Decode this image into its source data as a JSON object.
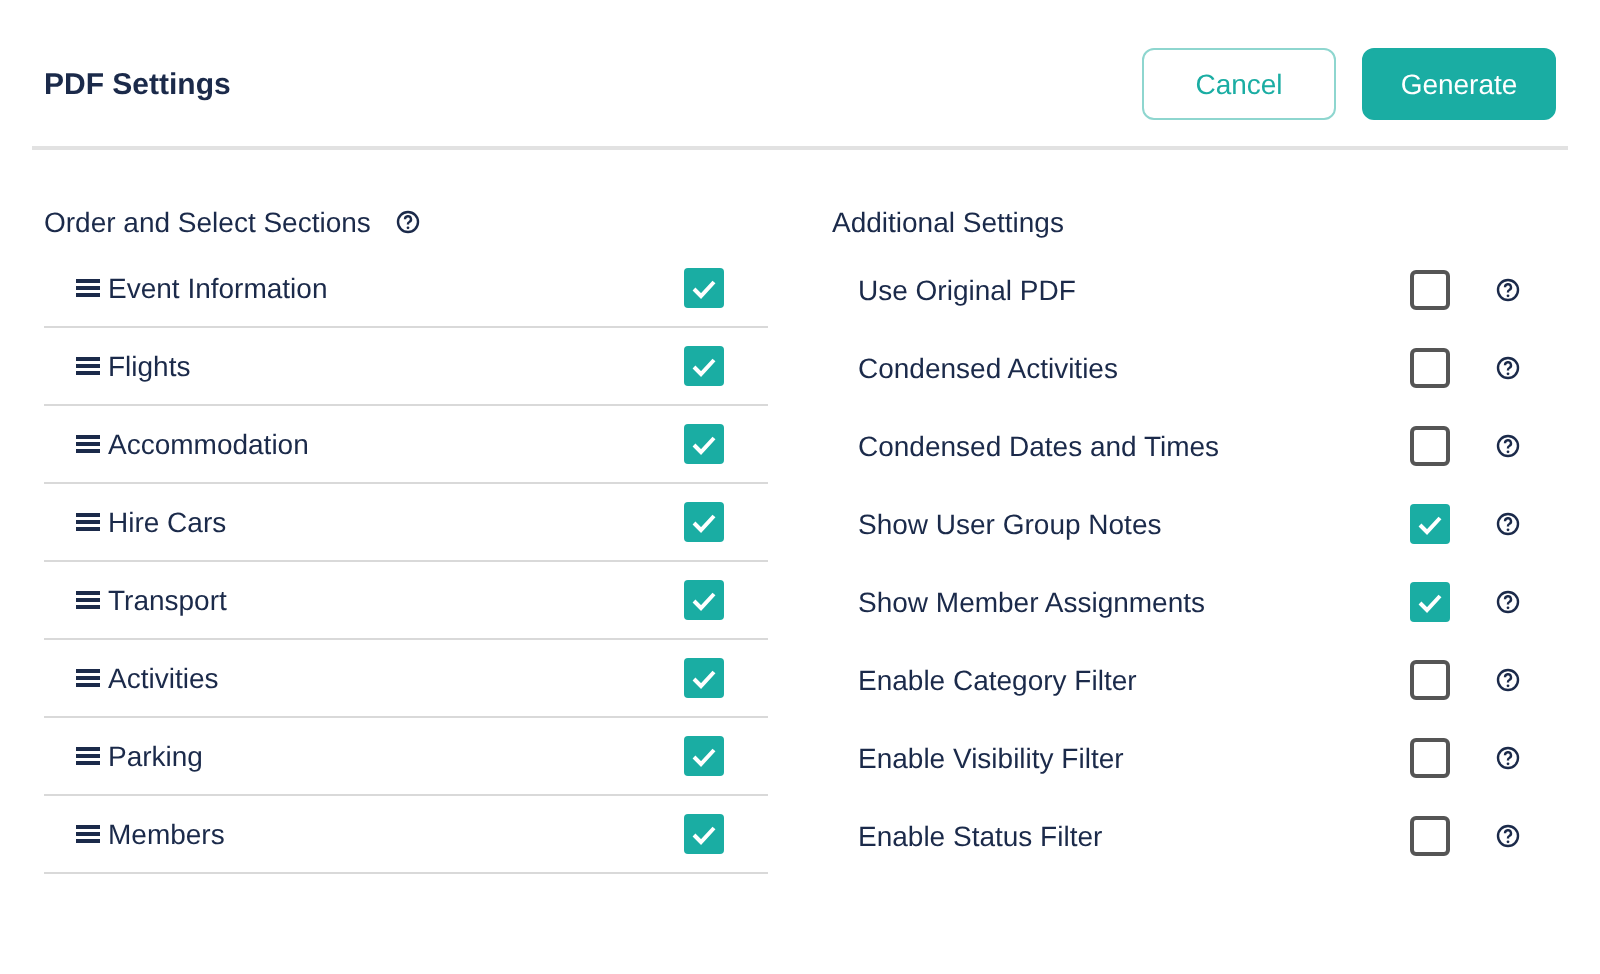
{
  "header": {
    "title": "PDF Settings",
    "buttons": [
      {
        "label": "Cancel",
        "kind": "secondary"
      },
      {
        "label": "Generate",
        "kind": "primary"
      }
    ]
  },
  "sections": {
    "title": "Order and Select Sections",
    "items": [
      {
        "label": "Event Information",
        "checked": true
      },
      {
        "label": "Flights",
        "checked": true
      },
      {
        "label": "Accommodation",
        "checked": true
      },
      {
        "label": "Hire Cars",
        "checked": true
      },
      {
        "label": "Transport",
        "checked": true
      },
      {
        "label": "Activities",
        "checked": true
      },
      {
        "label": "Parking",
        "checked": true
      },
      {
        "label": "Members",
        "checked": true
      }
    ]
  },
  "additional": {
    "title": "Additional Settings",
    "items": [
      {
        "label": "Use Original PDF",
        "checked": false
      },
      {
        "label": "Condensed Activities",
        "checked": false
      },
      {
        "label": "Condensed Dates and Times",
        "checked": false
      },
      {
        "label": "Show User Group Notes",
        "checked": true
      },
      {
        "label": "Show Member Assignments",
        "checked": true
      },
      {
        "label": "Enable Category Filter",
        "checked": false
      },
      {
        "label": "Enable Visibility Filter",
        "checked": false
      },
      {
        "label": "Enable Status Filter",
        "checked": false
      }
    ]
  }
}
